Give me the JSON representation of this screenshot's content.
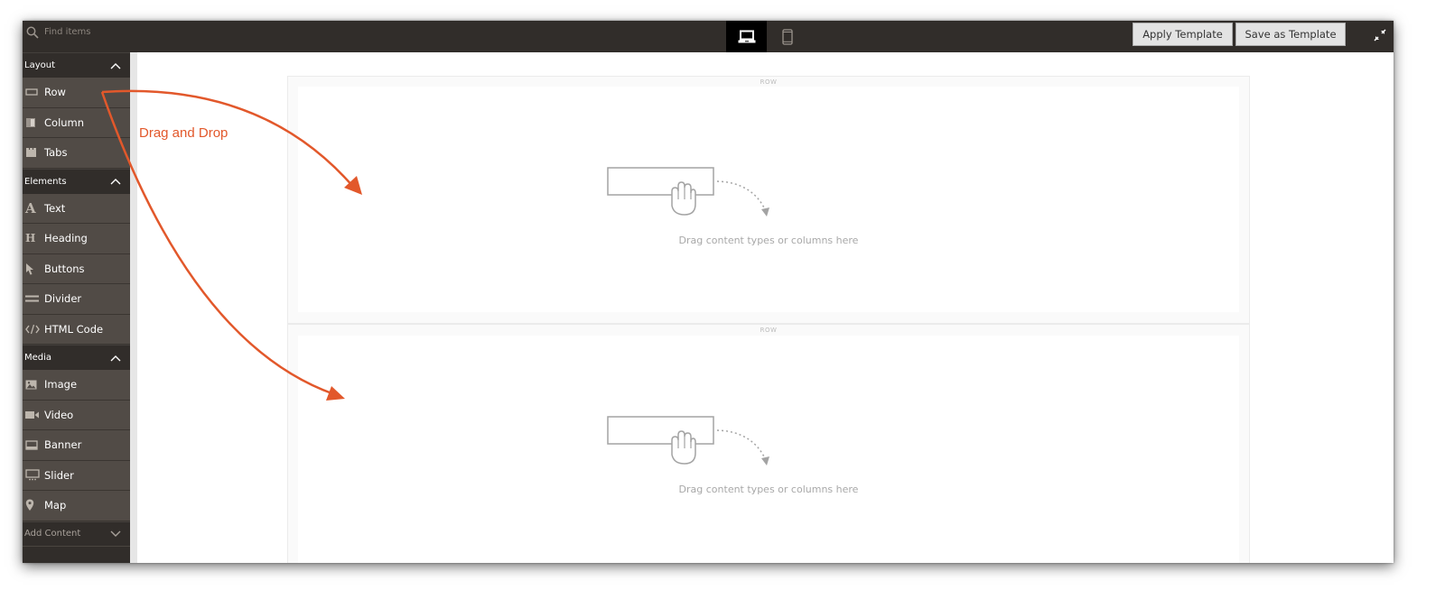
{
  "topbar": {
    "search_placeholder": "Find items",
    "devices": [
      {
        "name": "desktop",
        "icon": "laptop-icon",
        "active": true
      },
      {
        "name": "mobile",
        "icon": "mobile-phone-icon",
        "active": false
      }
    ],
    "apply_template_label": "Apply Template",
    "save_template_label": "Save as Template",
    "fullscreen_icon": "collapse-fullscreen-icon"
  },
  "sidebar": {
    "groups": [
      {
        "label": "Layout",
        "expanded": true,
        "items": [
          {
            "label": "Row",
            "icon": "row-icon"
          },
          {
            "label": "Column",
            "icon": "column-icon"
          },
          {
            "label": "Tabs",
            "icon": "tabs-icon"
          }
        ]
      },
      {
        "label": "Elements",
        "expanded": true,
        "items": [
          {
            "label": "Text",
            "icon": "text-icon"
          },
          {
            "label": "Heading",
            "icon": "heading-icon"
          },
          {
            "label": "Buttons",
            "icon": "cursor-pointer-icon"
          },
          {
            "label": "Divider",
            "icon": "divider-icon"
          },
          {
            "label": "HTML Code",
            "icon": "code-icon"
          }
        ]
      },
      {
        "label": "Media",
        "expanded": true,
        "items": [
          {
            "label": "Image",
            "icon": "image-icon"
          },
          {
            "label": "Video",
            "icon": "video-icon"
          },
          {
            "label": "Banner",
            "icon": "banner-icon"
          },
          {
            "label": "Slider",
            "icon": "slider-icon"
          },
          {
            "label": "Map",
            "icon": "map-pin-icon"
          }
        ]
      },
      {
        "label": "Add Content",
        "expanded": false,
        "items": []
      }
    ]
  },
  "canvas": {
    "rows": [
      {
        "label": "ROW",
        "drop_text": "Drag content types or columns here"
      },
      {
        "label": "ROW",
        "drop_text": "Drag content types or columns here"
      }
    ]
  },
  "annotation": {
    "label": "Drag and Drop",
    "color": "#e2582b"
  }
}
